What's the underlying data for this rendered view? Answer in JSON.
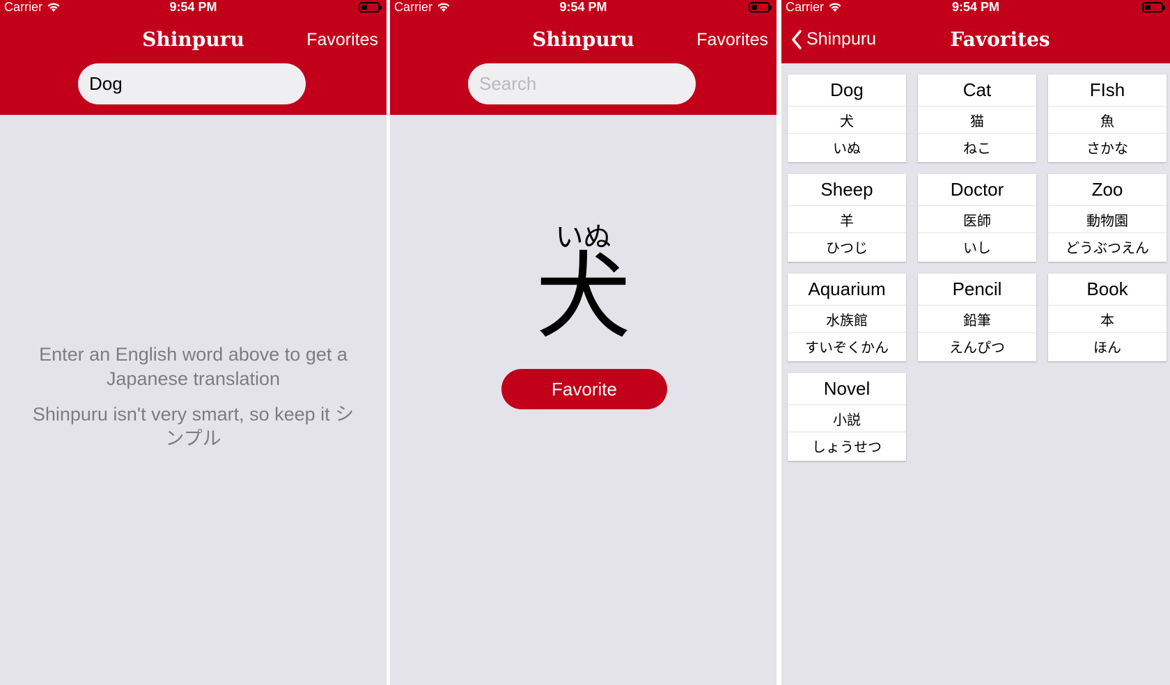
{
  "status_bar": {
    "carrier": "Carrier",
    "time": "9:54 PM"
  },
  "app_title": "Shinpuru",
  "nav": {
    "favorites_label": "Favorites",
    "back_label": "Shinpuru",
    "favorites_title": "Favorites"
  },
  "screen1": {
    "search_value": "Dog",
    "hint_line1": "Enter an English word above to get a Japanese translation",
    "hint_line2": "Shinpuru isn't very smart, so keep it シンプル"
  },
  "screen2": {
    "search_placeholder": "Search",
    "reading": "いぬ",
    "kanji": "犬",
    "favorite_button": "Favorite"
  },
  "favorites": [
    {
      "english": "Dog",
      "kanji": "犬",
      "kana": "いぬ"
    },
    {
      "english": "Cat",
      "kanji": "猫",
      "kana": "ねこ"
    },
    {
      "english": "FIsh",
      "kanji": "魚",
      "kana": "さかな"
    },
    {
      "english": "Sheep",
      "kanji": "羊",
      "kana": "ひつじ"
    },
    {
      "english": "Doctor",
      "kanji": "医師",
      "kana": "いし"
    },
    {
      "english": "Zoo",
      "kanji": "動物園",
      "kana": "どうぶつえん"
    },
    {
      "english": "Aquarium",
      "kanji": "水族館",
      "kana": "すいぞくかん"
    },
    {
      "english": "Pencil",
      "kanji": "鉛筆",
      "kana": "えんぴつ"
    },
    {
      "english": "Book",
      "kanji": "本",
      "kana": "ほん"
    },
    {
      "english": "Novel",
      "kanji": "小説",
      "kana": "しょうせつ"
    }
  ],
  "colors": {
    "brand_red": "#c2001a",
    "background": "#e4e3ea"
  },
  "icons": [
    "wifi-icon",
    "battery-icon",
    "back-chevron-icon"
  ]
}
